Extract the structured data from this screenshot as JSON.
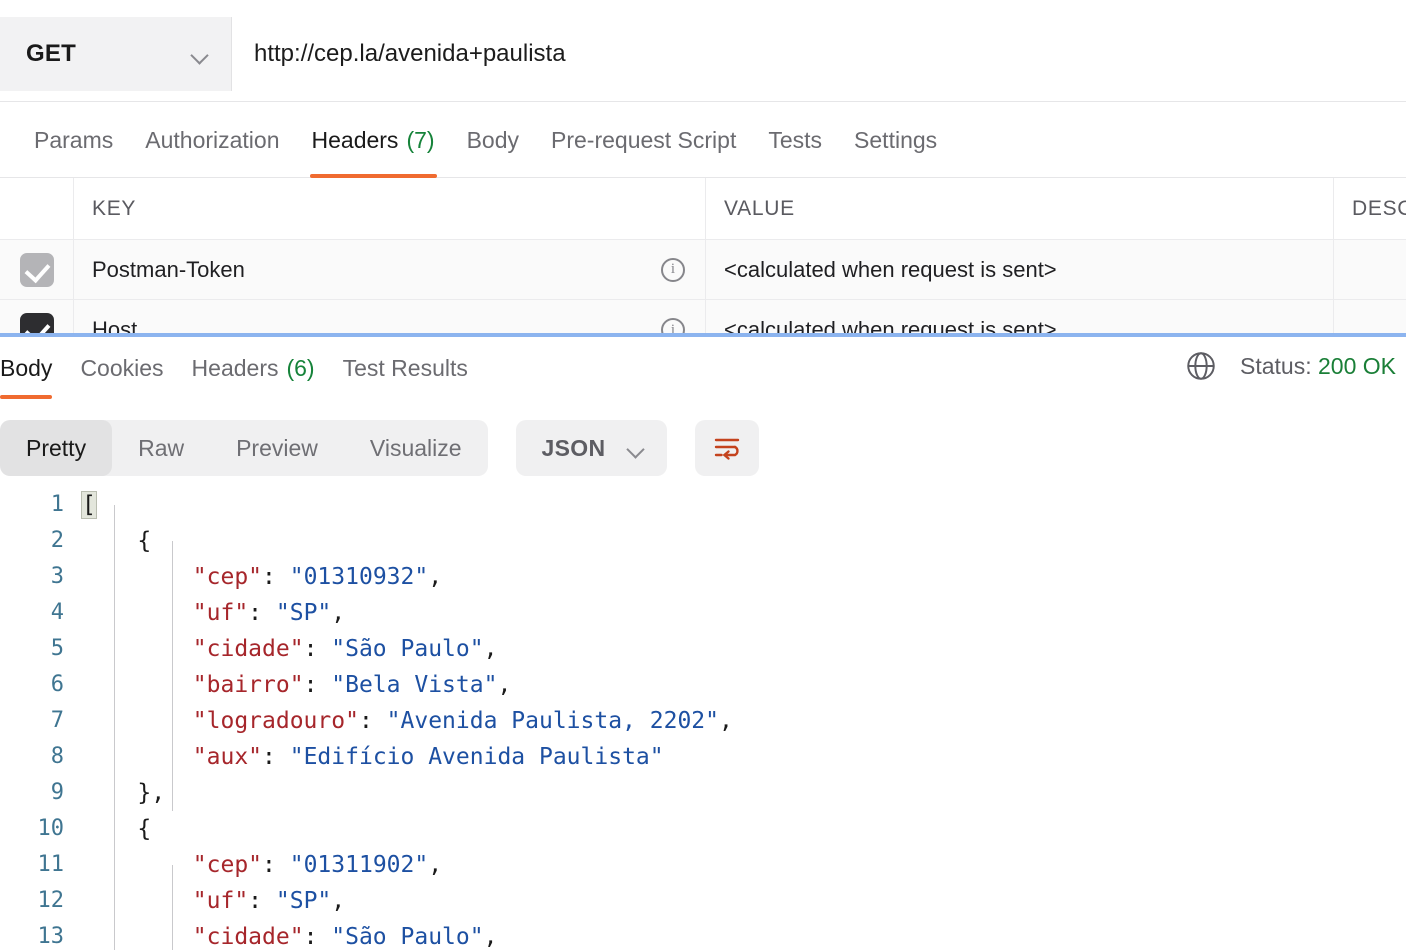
{
  "request": {
    "method": "GET",
    "url": "http://cep.la/avenida+paulista",
    "method_caret_icon": "chevron-down-icon",
    "tabs": [
      {
        "label": "Params",
        "count": null,
        "active": false
      },
      {
        "label": "Authorization",
        "count": null,
        "active": false
      },
      {
        "label": "Headers",
        "count": "(7)",
        "active": true
      },
      {
        "label": "Body",
        "count": null,
        "active": false
      },
      {
        "label": "Pre-request Script",
        "count": null,
        "active": false
      },
      {
        "label": "Tests",
        "count": null,
        "active": false
      },
      {
        "label": "Settings",
        "count": null,
        "active": false
      }
    ]
  },
  "headers_table": {
    "columns": [
      "KEY",
      "VALUE",
      "DESC"
    ],
    "rows": [
      {
        "checked": true,
        "checkbox_style": "gray",
        "key": "Postman-Token",
        "key_info_icon": "info-circle-icon",
        "value": "<calculated when request is sent>",
        "description": ""
      },
      {
        "checked": true,
        "checkbox_style": "dark",
        "key": "Host",
        "key_info_icon": "info-circle-icon",
        "value": "<calculated when request is sent>",
        "description": ""
      }
    ]
  },
  "response": {
    "tabs": [
      {
        "label": "Body",
        "count": null,
        "active": true
      },
      {
        "label": "Cookies",
        "count": null,
        "active": false
      },
      {
        "label": "Headers",
        "count": "(6)",
        "active": false
      },
      {
        "label": "Test Results",
        "count": null,
        "active": false
      }
    ],
    "globe_icon": "globe-icon",
    "status_label": "Status:",
    "status_value": "200 OK",
    "status_color": "#1a7f37",
    "view_modes": [
      {
        "label": "Pretty",
        "active": true
      },
      {
        "label": "Raw",
        "active": false
      },
      {
        "label": "Preview",
        "active": false
      },
      {
        "label": "Visualize",
        "active": false
      }
    ],
    "language": "JSON",
    "language_caret_icon": "chevron-down-icon",
    "wrap_button_icon": "word-wrap-icon",
    "wrap_button_color": "#c4431e",
    "accent_color": "#f06b30",
    "splitter_color": "#8cb4ef"
  },
  "body_code": {
    "syntax_colors": {
      "key": "#a6262b",
      "string": "#1d50a2",
      "punct": "#1a1a1a",
      "line_number": "#3f7591"
    },
    "lines": [
      {
        "n": "1",
        "indent": 0,
        "tokens": [
          {
            "t": "[",
            "c": "brk"
          }
        ]
      },
      {
        "n": "2",
        "indent": 1,
        "tokens": [
          {
            "t": "{",
            "c": "jp"
          }
        ]
      },
      {
        "n": "3",
        "indent": 2,
        "tokens": [
          {
            "t": "\"cep\"",
            "c": "jk"
          },
          {
            "t": ": ",
            "c": "jp"
          },
          {
            "t": "\"01310932\"",
            "c": "jv"
          },
          {
            "t": ",",
            "c": "jp"
          }
        ]
      },
      {
        "n": "4",
        "indent": 2,
        "tokens": [
          {
            "t": "\"uf\"",
            "c": "jk"
          },
          {
            "t": ": ",
            "c": "jp"
          },
          {
            "t": "\"SP\"",
            "c": "jv"
          },
          {
            "t": ",",
            "c": "jp"
          }
        ]
      },
      {
        "n": "5",
        "indent": 2,
        "tokens": [
          {
            "t": "\"cidade\"",
            "c": "jk"
          },
          {
            "t": ": ",
            "c": "jp"
          },
          {
            "t": "\"São Paulo\"",
            "c": "jv"
          },
          {
            "t": ",",
            "c": "jp"
          }
        ]
      },
      {
        "n": "6",
        "indent": 2,
        "tokens": [
          {
            "t": "\"bairro\"",
            "c": "jk"
          },
          {
            "t": ": ",
            "c": "jp"
          },
          {
            "t": "\"Bela Vista\"",
            "c": "jv"
          },
          {
            "t": ",",
            "c": "jp"
          }
        ]
      },
      {
        "n": "7",
        "indent": 2,
        "tokens": [
          {
            "t": "\"logradouro\"",
            "c": "jk"
          },
          {
            "t": ": ",
            "c": "jp"
          },
          {
            "t": "\"Avenida Paulista, 2202\"",
            "c": "jv"
          },
          {
            "t": ",",
            "c": "jp"
          }
        ]
      },
      {
        "n": "8",
        "indent": 2,
        "tokens": [
          {
            "t": "\"aux\"",
            "c": "jk"
          },
          {
            "t": ": ",
            "c": "jp"
          },
          {
            "t": "\"Edifício Avenida Paulista\"",
            "c": "jv"
          }
        ]
      },
      {
        "n": "9",
        "indent": 1,
        "tokens": [
          {
            "t": "},",
            "c": "jp"
          }
        ]
      },
      {
        "n": "10",
        "indent": 1,
        "tokens": [
          {
            "t": "{",
            "c": "jp"
          }
        ]
      },
      {
        "n": "11",
        "indent": 2,
        "tokens": [
          {
            "t": "\"cep\"",
            "c": "jk"
          },
          {
            "t": ": ",
            "c": "jp"
          },
          {
            "t": "\"01311902\"",
            "c": "jv"
          },
          {
            "t": ",",
            "c": "jp"
          }
        ]
      },
      {
        "n": "12",
        "indent": 2,
        "tokens": [
          {
            "t": "\"uf\"",
            "c": "jk"
          },
          {
            "t": ": ",
            "c": "jp"
          },
          {
            "t": "\"SP\"",
            "c": "jv"
          },
          {
            "t": ",",
            "c": "jp"
          }
        ]
      },
      {
        "n": "13",
        "indent": 2,
        "tokens": [
          {
            "t": "\"cidade\"",
            "c": "jk"
          },
          {
            "t": ": ",
            "c": "jp"
          },
          {
            "t": "\"São Paulo\"",
            "c": "jv"
          },
          {
            "t": ",",
            "c": "jp"
          }
        ]
      }
    ]
  }
}
